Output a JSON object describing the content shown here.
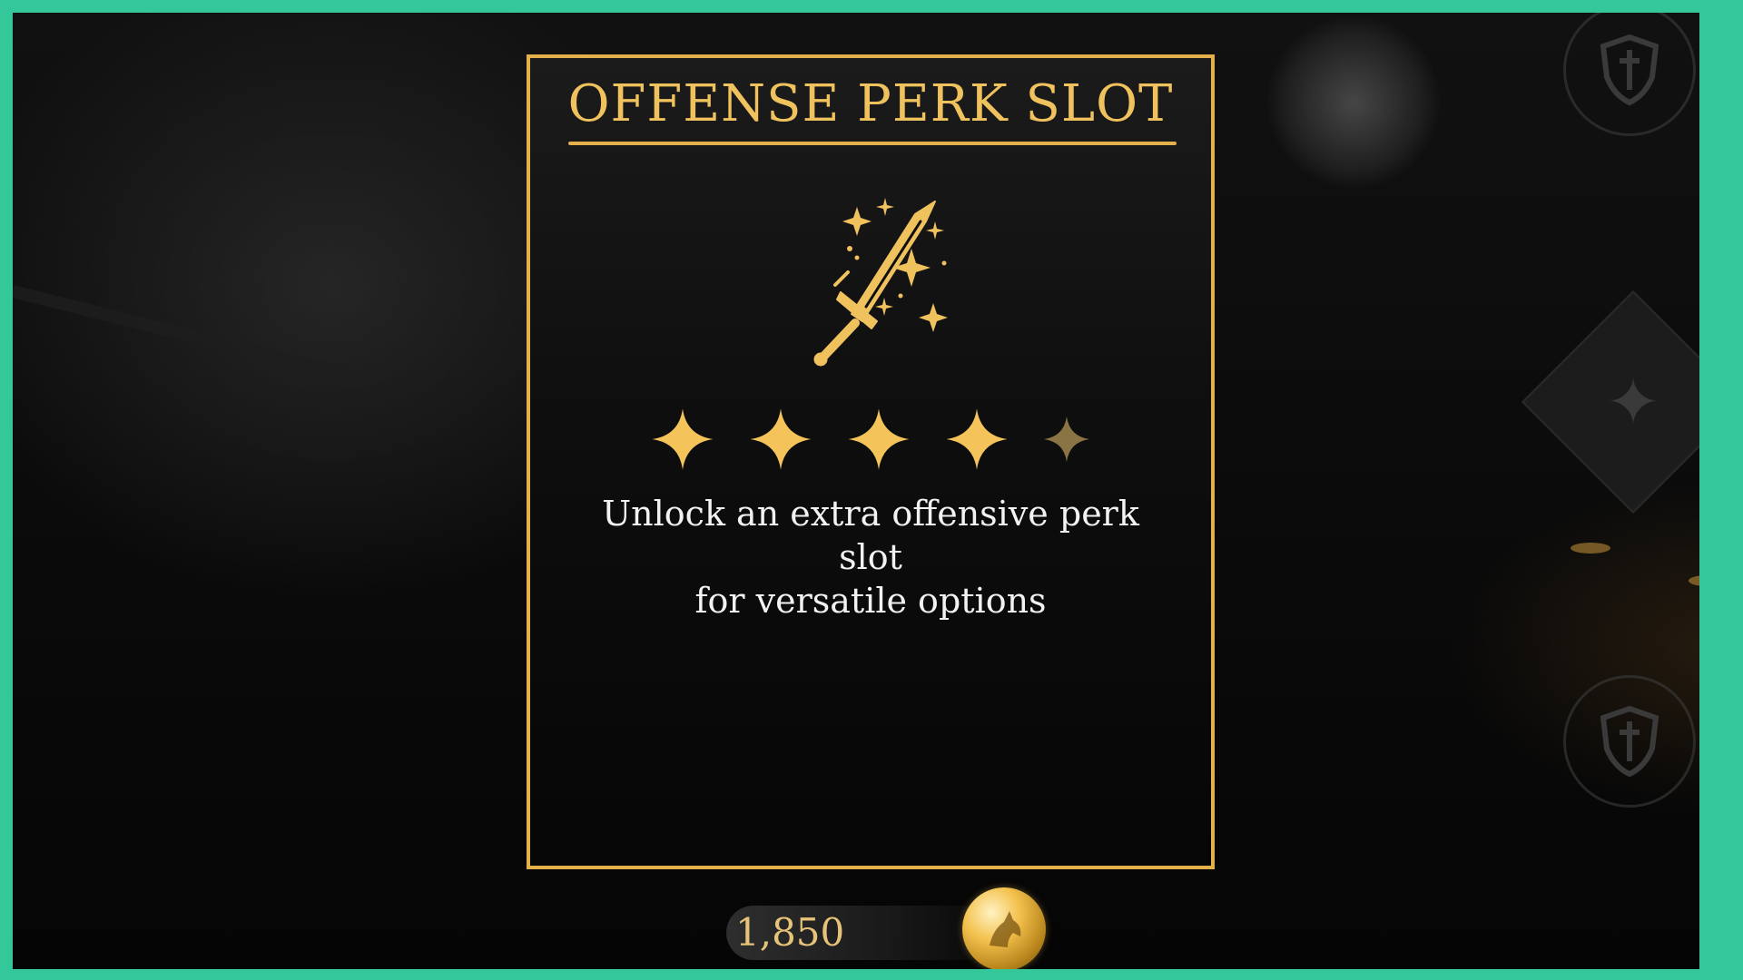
{
  "panel": {
    "title": "OFFENSE PERK SLOT",
    "icon": "sparkling-sword-icon",
    "rank": {
      "filled": 4,
      "total": 5
    },
    "description_line1": "Unlock an extra offensive perk slot",
    "description_line2": "for versatile options"
  },
  "cost": {
    "amount": "1,850",
    "currency_icon": "gold-coin-icon"
  },
  "colors": {
    "accent": "#e3b04b",
    "title": "#f0c25e",
    "star_filled": "#f4c45a",
    "star_empty": "#8a7443",
    "description": "#f2f2f2",
    "frame": "#34c79a"
  }
}
